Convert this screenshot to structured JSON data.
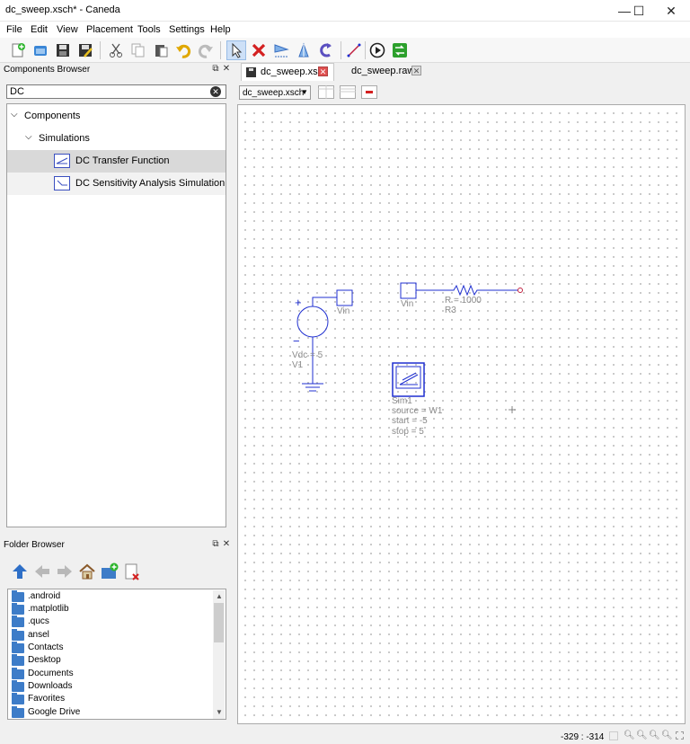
{
  "window": {
    "title": "dc_sweep.xsch* - Caneda",
    "minimize": "—",
    "maximize": "☐",
    "close": "✕"
  },
  "menu": [
    "File",
    "Edit",
    "View",
    "Placement",
    "Tools",
    "Settings",
    "Help"
  ],
  "toolbar": {
    "icons": [
      "new-file-icon",
      "open-file-icon",
      "save-icon",
      "save-all-icon",
      "cut-icon",
      "copy-icon",
      "paste-icon",
      "undo-icon",
      "redo-icon",
      "select-icon",
      "delete-icon",
      "mirror-x-icon",
      "mirror-y-icon",
      "rotate-icon",
      "wire-icon",
      "simulate-icon",
      "open-results-icon"
    ]
  },
  "components_browser": {
    "title": "Components Browser",
    "search_value": "DC",
    "tree": [
      {
        "label": "Components",
        "level": 0,
        "expanded": true
      },
      {
        "label": "Simulations",
        "level": 1,
        "expanded": true
      },
      {
        "label": "DC Transfer Function",
        "level": 2,
        "selected": true
      },
      {
        "label": "DC Sensitivity Analysis Simulation",
        "level": 2
      }
    ]
  },
  "folder_browser": {
    "title": "Folder Browser",
    "folders": [
      ".android",
      ".matplotlib",
      ".qucs",
      "ansel",
      "Contacts",
      "Desktop",
      "Documents",
      "Downloads",
      "Favorites",
      "Google Drive"
    ]
  },
  "tabs": [
    {
      "label": "dc_sweep.xsch",
      "active": true
    },
    {
      "label": "dc_sweep.raw",
      "active": false
    }
  ],
  "doc_select": "dc_sweep.xsch",
  "schematic": {
    "vsource": {
      "plus": "+",
      "minus": "−",
      "value": "Vdc = 5",
      "name": "V1"
    },
    "port_left": "Vin",
    "port_right": "Vin",
    "resistor": {
      "value": "R = 1000",
      "name": "R3"
    },
    "sim": {
      "name": "Sim1",
      "source": "source = W1",
      "start": "start = -5",
      "stop": "stop = 5"
    }
  },
  "status": {
    "coords": "-329 : -314"
  },
  "colors": {
    "wire": "#1f2fd0",
    "accent": "#3a4fc0"
  }
}
